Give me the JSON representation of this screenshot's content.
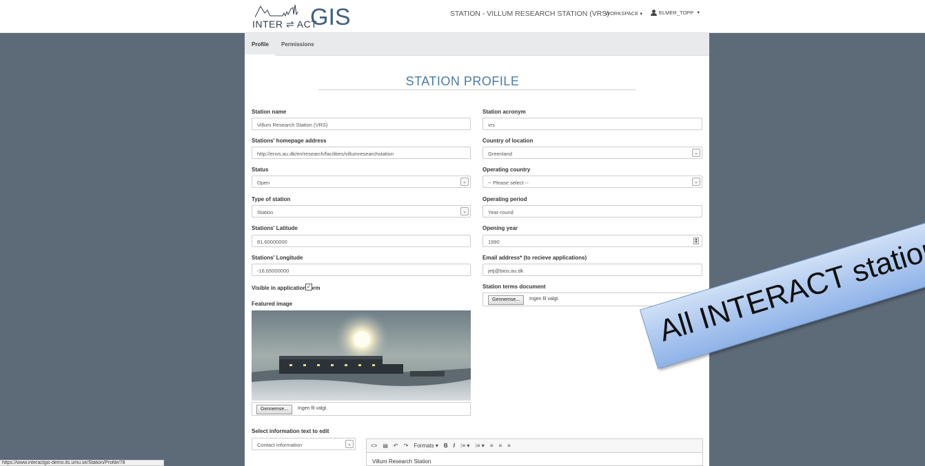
{
  "header": {
    "logo_text_left": "INTER ⇌ ACT",
    "logo_text_right": "GIS",
    "station_title": "STATION - VILLUM RESEARCH STATION (VRS)",
    "workspace_label": "WORKSPACE",
    "user_label": "ELMER_TOPP"
  },
  "tabs": [
    {
      "label": "Profile",
      "active": true
    },
    {
      "label": "Permissions",
      "active": false
    }
  ],
  "page_heading": "STATION PROFILE",
  "form": {
    "station_name": {
      "label": "Station name",
      "value": "Villum Research Station (VRS)"
    },
    "station_acronym": {
      "label": "Station acronym",
      "value": "vrs"
    },
    "homepage": {
      "label": "Stations' homepage address",
      "value": "http://envs.au.dk/en/research/facilities/villumresearchstation"
    },
    "country_of_location": {
      "label": "Country of location",
      "value": "Greenland"
    },
    "status": {
      "label": "Status",
      "value": "Open"
    },
    "operating_country": {
      "label": "Operating country",
      "value": "-- Please select --"
    },
    "type_of_station": {
      "label": "Type of station",
      "value": "Station"
    },
    "operating_period": {
      "label": "Operating period",
      "value": "Year-round"
    },
    "latitude": {
      "label": "Stations' Latitude",
      "value": "81,60000000"
    },
    "opening_year": {
      "label": "Opening year",
      "value": "1990"
    },
    "longitude": {
      "label": "Stations' Longitude",
      "value": "-16,65000000"
    },
    "email": {
      "label": "Email address* (to recieve applications)",
      "value": "jetj@bios.au.dk"
    },
    "visible_in_form": {
      "label": "Visible in application form",
      "checked": true,
      "check_glyph": "✓"
    },
    "terms_document": {
      "label": "Station terms document",
      "button": "Gennemse...",
      "status": "Ingen fil valgt."
    },
    "featured_image": {
      "label": "Featured image",
      "button": "Gennemse...",
      "status": "Ingen fil valgt."
    },
    "info_text_select": {
      "label": "Select information text to edit",
      "value": "Contact information"
    }
  },
  "editor": {
    "toolbar": [
      "<>",
      "▤",
      "↶",
      "↷",
      "Formats ▾",
      "B",
      "I",
      "⁝≡ ▾",
      "⁝≡ ▾",
      "≡",
      "≡",
      "≡"
    ],
    "content": "Villum Research Station"
  },
  "status_bar_url": "https://www.interactgis-demo.its.umu.se/Station/Profile/78",
  "callout": "All INTERACT stations"
}
